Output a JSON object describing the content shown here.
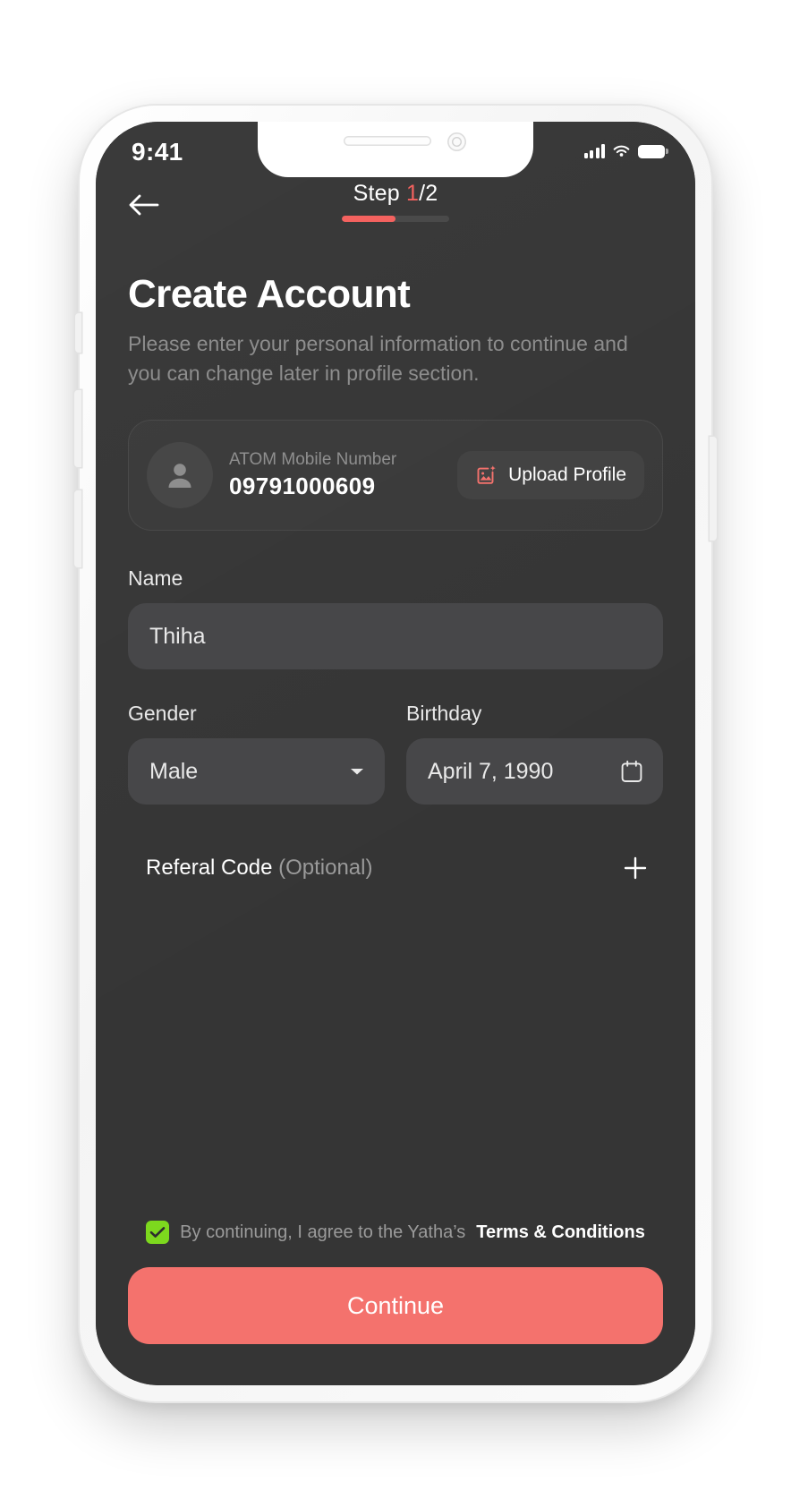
{
  "status_bar": {
    "time": "9:41",
    "signal_icon": "cellular-signal-icon",
    "wifi_icon": "wifi-icon",
    "battery_icon": "battery-icon"
  },
  "nav": {
    "back_icon": "back-arrow-icon",
    "step_prefix": "Step ",
    "step_current": "1",
    "step_separator": "/",
    "step_total": "2",
    "progress_percent": 50
  },
  "header": {
    "title": "Create Account",
    "subtitle": "Please enter your personal information to continue and you can change later in profile section."
  },
  "profile_card": {
    "avatar_icon": "person-icon",
    "label": "ATOM Mobile Number",
    "value": "09791000609",
    "upload_button": {
      "label": "Upload Profile",
      "icon": "image-upload-icon"
    }
  },
  "form": {
    "name": {
      "label": "Name",
      "value": "Thiha"
    },
    "gender": {
      "label": "Gender",
      "value": "Male",
      "chevron_icon": "chevron-down-icon"
    },
    "birthday": {
      "label": "Birthday",
      "value": "April 7, 1990",
      "calendar_icon": "calendar-icon"
    },
    "referral": {
      "label": "Referal Code",
      "optional": " (Optional)",
      "add_icon": "plus-icon"
    }
  },
  "terms": {
    "checked": true,
    "check_icon": "checkmark-icon",
    "text": "By continuing, I agree to the Yatha’s",
    "link": "Terms & Conditions"
  },
  "continue_button": {
    "label": "Continue"
  },
  "colors": {
    "accent": "#F4726D",
    "accent_step": "#F4625F",
    "screen_bg": "#353535",
    "input_bg": "#474749",
    "checkbox_green": "#7DD81E"
  }
}
